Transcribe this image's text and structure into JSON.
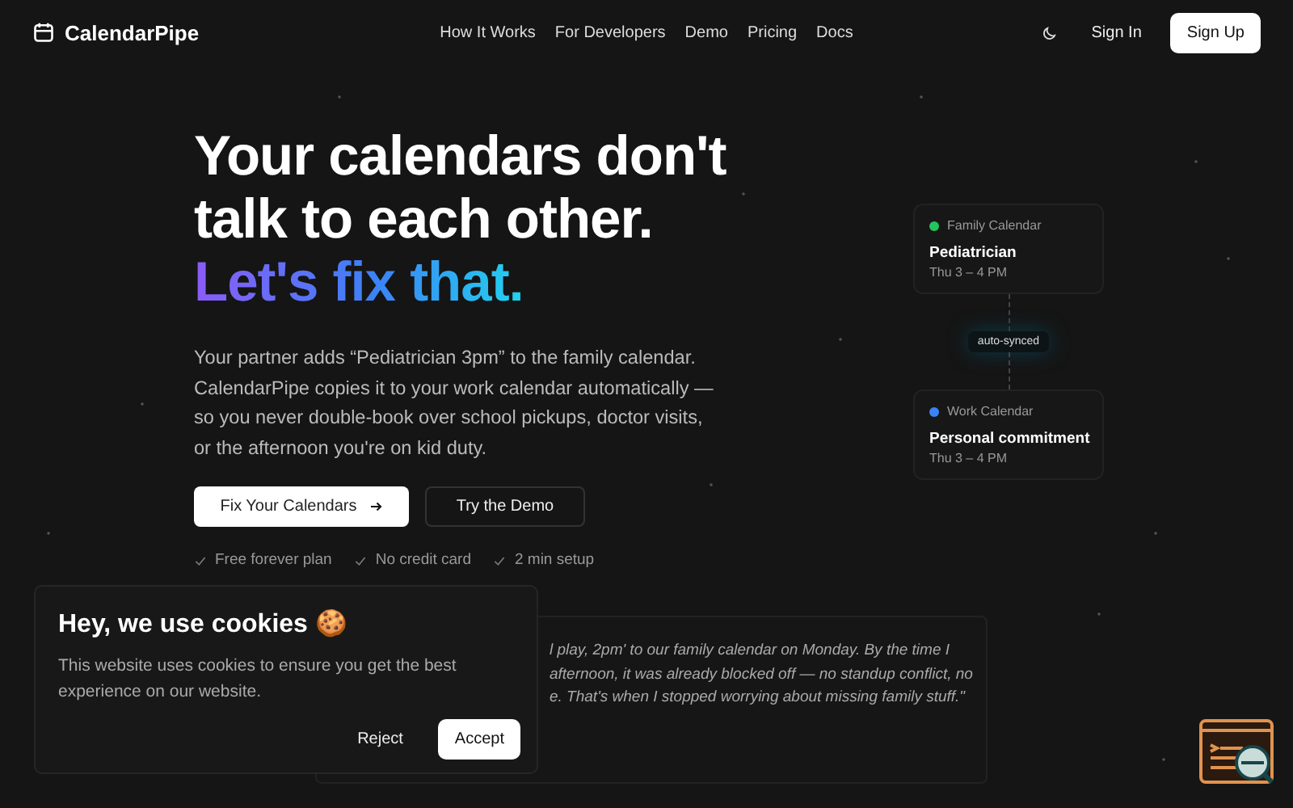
{
  "nav": {
    "brand": "CalendarPipe",
    "links": [
      {
        "label": "How It Works"
      },
      {
        "label": "For Developers"
      },
      {
        "label": "Demo"
      },
      {
        "label": "Pricing"
      },
      {
        "label": "Docs"
      }
    ],
    "sign_in": "Sign In",
    "sign_up": "Sign Up"
  },
  "hero": {
    "title_lines": [
      "Your calendars don't",
      "talk to each other."
    ],
    "title_accent": "Let's fix that.",
    "body": "Your partner adds “Pediatrician 3pm” to the family calendar. CalendarPipe copies it to your work calendar automatically — so you never double-book over school pickups, doctor visits, or the afternoon you're on kid duty.",
    "primary_button": "Fix Your Calendars",
    "secondary_button": "Try the Demo",
    "perks": [
      "Free forever plan",
      "No credit card",
      "2 min setup"
    ]
  },
  "sync": {
    "cards": [
      {
        "calendar": "Family Calendar",
        "color": "#22c55e",
        "event": "Pediatrician",
        "time": "Thu 3 – 4 PM"
      },
      {
        "calendar": "Work Calendar",
        "color": "#3b82f6",
        "event": "Personal commitment",
        "time": "Thu 3 – 4 PM"
      }
    ],
    "badge": "auto-synced"
  },
  "testimonial": {
    "lines": [
      "l play, 2pm' to our family calendar on Monday. By the time I",
      "afternoon, it was already blocked off — no standup conflict, no",
      "e. That's when I stopped worrying about missing family stuff.\""
    ]
  },
  "cookie_banner": {
    "title": "Hey, we use cookies 🍪",
    "text": "This website uses cookies to ensure you get the best experience on our website.",
    "reject": "Reject",
    "accept": "Accept"
  }
}
